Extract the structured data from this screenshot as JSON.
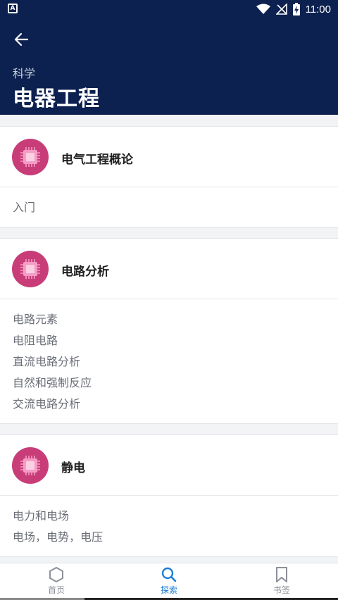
{
  "status": {
    "time": "11:00",
    "battery_icon": "battery-charging-icon",
    "wifi_icon": "wifi-icon",
    "signal_icon": "no-signal-icon"
  },
  "header": {
    "subject": "科学",
    "title": "电器工程",
    "back_icon": "arrow-left-icon"
  },
  "cards": [
    {
      "title": "电气工程概论",
      "icon": "chip-icon",
      "topics": [
        "入门"
      ]
    },
    {
      "title": "电路分析",
      "icon": "chip-icon",
      "topics": [
        "电路元素",
        "电阻电路",
        "直流电路分析",
        "自然和强制反应",
        "交流电路分析"
      ]
    },
    {
      "title": "静电",
      "icon": "chip-icon",
      "topics": [
        "电力和电场",
        "电场，电势，电压"
      ]
    }
  ],
  "bottom_nav": [
    {
      "label": "首页",
      "icon": "hexagon-icon",
      "active": false
    },
    {
      "label": "探索",
      "icon": "search-icon",
      "active": true
    },
    {
      "label": "书签",
      "icon": "bookmark-icon",
      "active": false
    }
  ],
  "colors": {
    "header_bg": "#0d2150",
    "accent": "#1c7ed6",
    "avatar_bg": "#c83d78",
    "chip": "#f59bc6"
  }
}
